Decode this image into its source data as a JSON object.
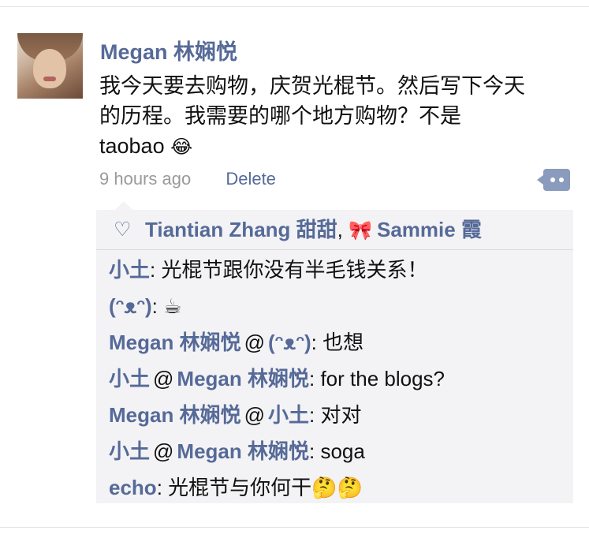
{
  "post": {
    "author": "Megan 林娴悦",
    "text_line1": "我今天要去购物，庆贺光棍节。然后写下今天",
    "text_line2": "的历程。我需要的哪个地方购物？不是",
    "text_line3": "taobao",
    "text_emoji": "😂",
    "time": "9 hours ago",
    "delete_label": "Delete"
  },
  "likes": {
    "liker1": "Tiantian Zhang 甜甜",
    "separator": ",",
    "liker2_emoji": "🎀",
    "liker2": "Sammie 霞"
  },
  "comments": [
    {
      "author": "小土",
      "at": "",
      "target": "",
      "text": ": 光棍节跟你没有半毛钱关系！"
    },
    {
      "author": "(ᵔᴥᵔ)",
      "at": "",
      "target": "",
      "text": ": ☕"
    },
    {
      "author": "Megan 林娴悦",
      "at": "@",
      "target": "(ᵔᴥᵔ)",
      "text": ": 也想"
    },
    {
      "author": "小土",
      "at": "@",
      "target": "Megan 林娴悦",
      "text": ": for the blogs?"
    },
    {
      "author": "Megan 林娴悦",
      "at": "@",
      "target": "小土",
      "text": ": 对对"
    },
    {
      "author": "小土",
      "at": "@",
      "target": "Megan 林娴悦",
      "text": ": soga"
    },
    {
      "author": "echo",
      "at": "",
      "target": "",
      "text": ": 光棍节与你何干🤔🤔"
    }
  ],
  "colors": {
    "name": "#566a98",
    "meta": "#9a9a9a",
    "panel_bg": "#f3f3f5"
  }
}
